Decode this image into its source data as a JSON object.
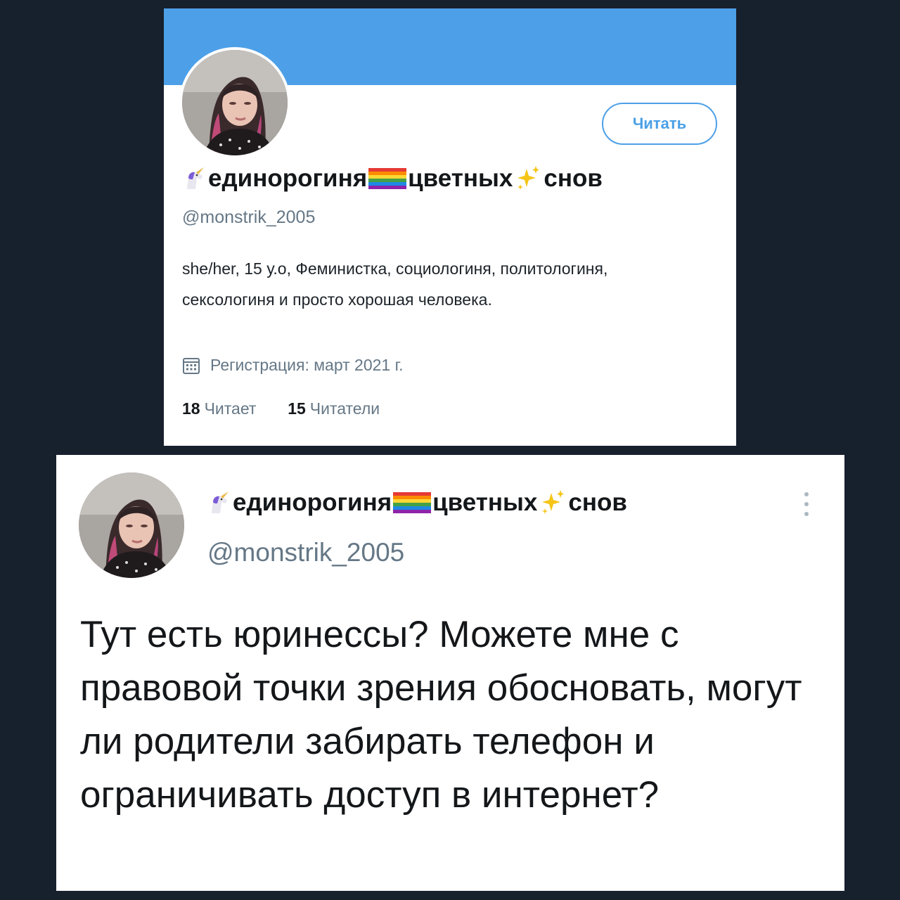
{
  "profile": {
    "display_name_parts": [
      "единорогиня",
      "цветных",
      "снов"
    ],
    "handle": "@monstrik_2005",
    "follow_button_label": "Читать",
    "bio": "she/her, 15 у.о, Феминистка, социологиня, политологиня, сексологиня и просто хорошая человека.",
    "joined": "Регистрация: март 2021 г.",
    "following_count": "18",
    "following_label": "Читает",
    "followers_count": "15",
    "followers_label": "Читатели",
    "banner_color": "#4da0e8",
    "icons": [
      "unicorn-icon",
      "rainbow-flag-icon",
      "sparkles-icon",
      "calendar-icon"
    ]
  },
  "tweet": {
    "display_name_parts": [
      "единорогиня",
      "цветных",
      "снов"
    ],
    "handle": "@monstrik_2005",
    "text": "Тут есть юринессы? Можете мне с правовой точки зрения обосновать, могут ли родители забирать телефон и ограничивать доступ в интернет?",
    "icons": [
      "unicorn-icon",
      "rainbow-flag-icon",
      "sparkles-icon",
      "more-vertical-icon"
    ]
  },
  "colors": {
    "page_background": "#17202d",
    "accent": "#4da0e8",
    "secondary_text": "#657786"
  }
}
